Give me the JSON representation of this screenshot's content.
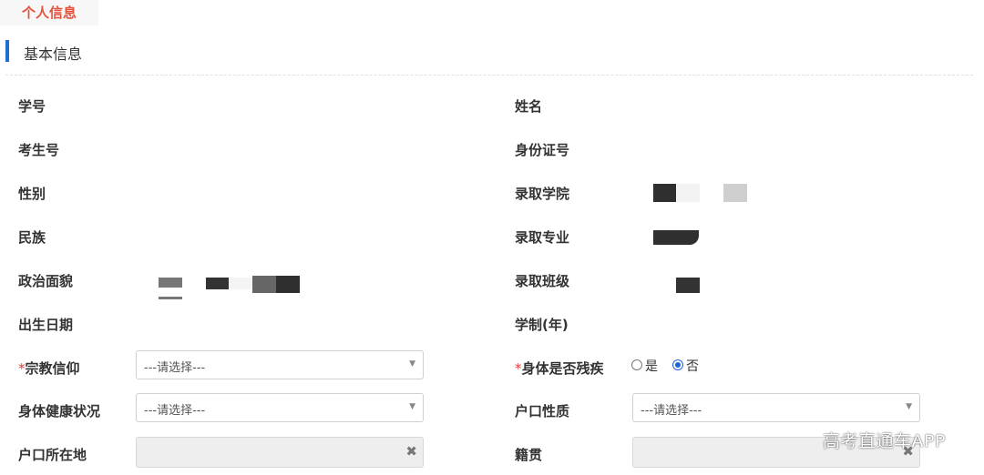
{
  "tab": {
    "label": "个人信息"
  },
  "section": {
    "title": "基本信息"
  },
  "fields": {
    "student_id": "学号",
    "name": "姓名",
    "exam_number": "考生号",
    "id_number": "身份证号",
    "gender": "性别",
    "college": "录取学院",
    "ethnicity": "民族",
    "major": "录取专业",
    "political_status": "政治面貌",
    "class": "录取班级",
    "birth_date": "出生日期",
    "study_years": "学制(年)",
    "religion": "宗教信仰",
    "disability": "身体是否残疾",
    "health": "身体健康状况",
    "household_type": "户口性质",
    "household_location": "户口所在地",
    "native_place": "籍贯"
  },
  "required_mark": "*",
  "religion_select": {
    "value": "---请选择---"
  },
  "health_select": {
    "value": "---请选择---"
  },
  "household_type_select": {
    "value": "---请选择---"
  },
  "disability_radio": {
    "options": [
      "是",
      "否"
    ],
    "selected": "否"
  },
  "icons": {
    "caret": "▼",
    "clear": "✖"
  },
  "watermark": "高考直通车APP",
  "colors": {
    "accent_red": "#e5533d",
    "section_bar": "#1f6fd1",
    "radio_selected": "#1e63d6"
  }
}
